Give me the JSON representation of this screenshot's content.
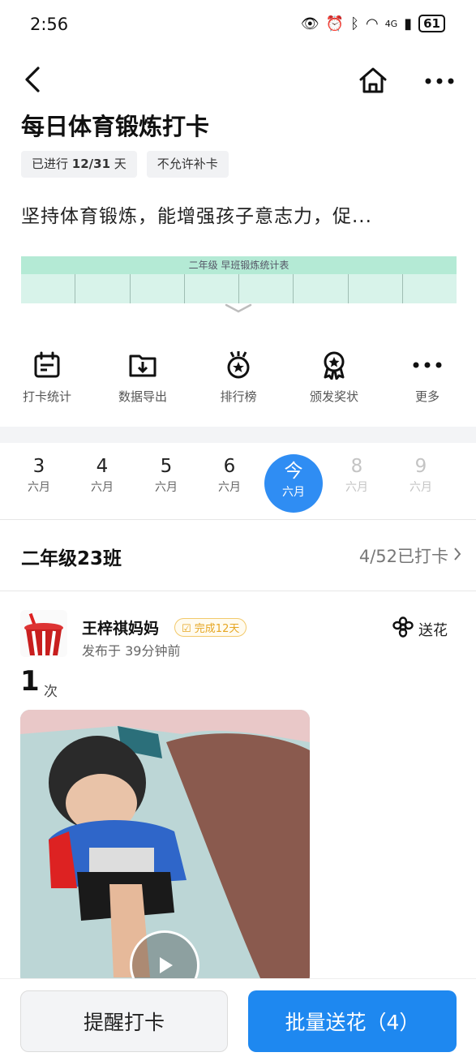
{
  "status_bar": {
    "time": "2:56",
    "battery": "61",
    "network": "4G"
  },
  "page": {
    "title": "每日体育锻炼打卡"
  },
  "tags": {
    "progress_prefix": "已进行 ",
    "progress_value": "12/31",
    "progress_suffix": " 天",
    "no_makeup": "不允许补卡"
  },
  "description": "坚持体育锻炼，能增强孩子意志力，促...",
  "preview_table": {
    "title": "二年级 早班锻炼统计表"
  },
  "tools": [
    {
      "label": "打卡统计",
      "icon": "calendar-icon"
    },
    {
      "label": "数据导出",
      "icon": "folder-download-icon"
    },
    {
      "label": "排行榜",
      "icon": "medal-icon"
    },
    {
      "label": "颁发奖状",
      "icon": "award-ribbon-icon"
    },
    {
      "label": "更多",
      "icon": "more-dots-icon"
    }
  ],
  "dates": [
    {
      "num": "3",
      "month": "六月",
      "state": "past"
    },
    {
      "num": "4",
      "month": "六月",
      "state": "past"
    },
    {
      "num": "5",
      "month": "六月",
      "state": "past"
    },
    {
      "num": "6",
      "month": "六月",
      "state": "past"
    },
    {
      "num": "今",
      "month": "六月",
      "state": "today"
    },
    {
      "num": "8",
      "month": "六月",
      "state": "future"
    },
    {
      "num": "9",
      "month": "六月",
      "state": "future"
    }
  ],
  "class_row": {
    "name": "二年级23班",
    "count": "4/52已打卡"
  },
  "post": {
    "author": "王梓祺妈妈",
    "badge": "完成12天",
    "time": "发布于 39分钟前",
    "send_flower": "送花",
    "count": "1",
    "count_unit": "次"
  },
  "bottom": {
    "remind": "提醒打卡",
    "batch": "批量送花（4）"
  },
  "colors": {
    "accent": "#1e88f0",
    "today": "#2f8df3",
    "badge": "#e6a623"
  }
}
